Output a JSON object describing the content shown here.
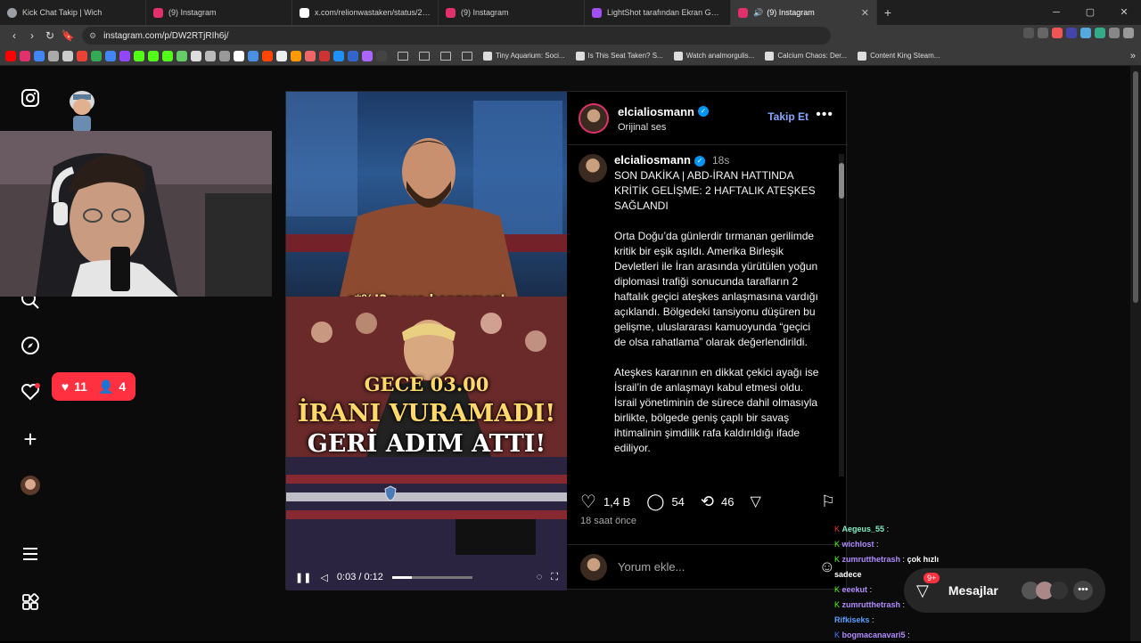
{
  "tabs": [
    {
      "title": "Kick Chat Takip | Wich",
      "color": "#9aa0a6"
    },
    {
      "title": "(9) Instagram",
      "color": "#e1306c"
    },
    {
      "title": "x.com/relionwastaken/status/204002",
      "color": "#ffffff"
    },
    {
      "title": "(9) Instagram",
      "color": "#e1306c"
    },
    {
      "title": "LightShot tarafından Ekran Görüntüs",
      "color": "#a34df5"
    },
    {
      "title": "(9) Instagram",
      "color": "#e1306c"
    }
  ],
  "url": "instagram.com/p/DW2RTjRIh6j/",
  "bookmarks": [
    "Tiny Aquarium: Soci...",
    "Is This Seat Taken? S...",
    "Watch analmorgulis...",
    "Calcium Chaos: Der...",
    "Content King Steam..."
  ],
  "notif": {
    "likes": "11",
    "follows": "4"
  },
  "post": {
    "username": "elcialiosmann",
    "audio": "Orijinal ses",
    "follow_label": "Takip Et",
    "time": "18s",
    "headline": "SON DAKİKA | ABD-İRAN HATTINDA KRİTİK GELİŞME: 2 HAFTALIK ATEŞKES SAĞLANDI",
    "para1": "Orta Doğu’da günlerdir tırmanan gerilimde kritik bir eşik aşıldı. Amerika Birleşik Devletleri ile İran arasında yürütülen yoğun diplomasi trafiği sonucunda tarafların 2 haftalık geçici ateşkes anlaşmasına vardığı açıklandı. Bölgedeki tansiyonu düşüren bu gelişme, uluslararası kamuoyunda “geçici de olsa rahatlama” olarak değerlendirildi.",
    "para2": "Ateşkes kararının en dikkat çekici ayağı ise İsrail’in de anlaşmayı kabul etmesi oldu. İsrail yönetiminin de sürece dahil olmasıyla birlikte, bölgede geniş çaplı bir savaş ihtimalinin şimdilik rafa kaldırıldığı ifade ediliyor.",
    "likes": "1,4 B",
    "comments": "54",
    "reposts": "46",
    "ago": "18 saat önce",
    "comment_placeholder": "Yorum ekle..."
  },
  "video": {
    "caption": "s*%!?meye benzemez!",
    "line1": "GECE 03.00",
    "line2": "İRANI VURAMADI!",
    "line3": "GERİ ADIM ATTI!",
    "time": "0:03 / 0:12",
    "progress": 0.25
  },
  "chat": [
    {
      "user": "Aegeus_55",
      "msg": "",
      "color": "#7ef1c4"
    },
    {
      "user": "wichlost",
      "msg": "",
      "color": "#b08cff"
    },
    {
      "user": "zumrutthetrash",
      "msg": "çok hızlı sadece",
      "color": "#b08cff"
    },
    {
      "user": "eeekut",
      "msg": "",
      "color": "#b08cff"
    },
    {
      "user": "zumrutthetrash",
      "msg": "",
      "color": "#b08cff"
    },
    {
      "user": "Rifkiseks",
      "msg": "",
      "color": "#5aa0ff"
    },
    {
      "user": "bogmacanavari5",
      "msg": "",
      "color": "#b08cff"
    }
  ],
  "messages": {
    "label": "Mesajlar",
    "badge": "9+"
  }
}
